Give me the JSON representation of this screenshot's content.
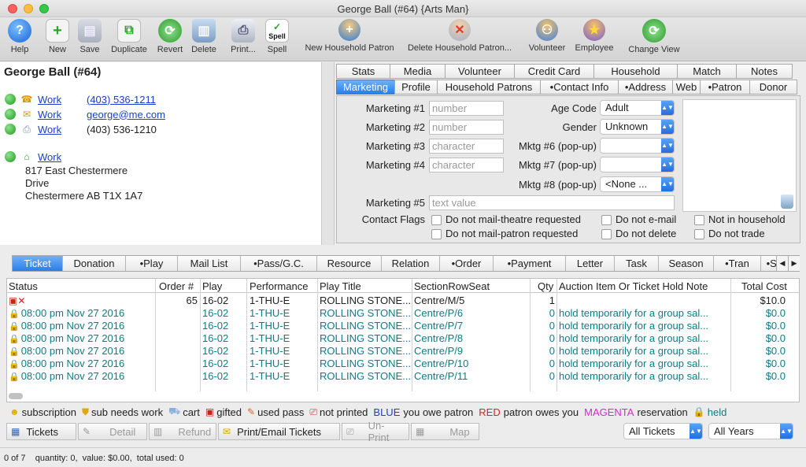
{
  "window": {
    "title": "George Ball (#64) {Arts Man}"
  },
  "toolbar": {
    "help": "Help",
    "new": "New",
    "save": "Save",
    "duplicate": "Duplicate",
    "revert": "Revert",
    "delete": "Delete",
    "print": "Print...",
    "spell": "Spell",
    "spell_badge": "Spell",
    "new_household_patron": "New Household Patron",
    "delete_household_patron": "Delete Household Patron...",
    "volunteer": "Volunteer",
    "employee": "Employee",
    "change_view": "Change View"
  },
  "contact": {
    "name": "George Ball (#64)",
    "phones": [
      {
        "type": "Work",
        "value": "(403) 536-1211",
        "linked": true
      },
      {
        "type": "Work",
        "value": "george@me.com",
        "linked": true
      },
      {
        "type": "Work",
        "value": "(403) 536-1210",
        "linked": false
      }
    ],
    "address": {
      "type": "Work",
      "line1": "817 East Chestermere",
      "line2": "Drive",
      "line3": "Chestermere AB  T1X 1A7"
    }
  },
  "right_tabs": {
    "row1": [
      "Stats",
      "Media",
      "Volunteer",
      "Credit Card",
      "Household",
      "Match",
      "Notes"
    ],
    "row2": [
      "Marketing",
      "Profile",
      "Household Patrons",
      "•Contact Info",
      "•Address",
      "Web",
      "•Patron",
      "Donor"
    ],
    "active": "Marketing"
  },
  "marketing": {
    "m1_label": "Marketing #1",
    "m1_placeholder": "number",
    "m2_label": "Marketing #2",
    "m2_placeholder": "number",
    "m3_label": "Marketing #3",
    "m3_placeholder": "character",
    "m4_label": "Marketing #4",
    "m4_placeholder": "character",
    "m5_label": "Marketing #5",
    "m5_placeholder": "text value",
    "age_label": "Age Code",
    "age_value": "Adult",
    "gender_label": "Gender",
    "gender_value": "Unknown",
    "m6_label": "Mktg #6 (pop-up)",
    "m6_value": "",
    "m7_label": "Mktg #7 (pop-up)",
    "m7_value": "",
    "m8_label": "Mktg #8 (pop-up)",
    "m8_value": "<None ...",
    "flags_label": "Contact Flags",
    "flags": [
      "Do not mail-theatre requested",
      "Do not e-mail",
      "Not in household",
      "Do not mail-patron requested",
      "Do not delete",
      "Do not trade"
    ]
  },
  "bottom_tabs": [
    "Ticket",
    "Donation",
    "•Play",
    "Mail List",
    "•Pass/G.C.",
    "Resource",
    "Relation",
    "•Order",
    "•Payment",
    "Letter",
    "Task",
    "Season",
    "•Tran",
    "•St"
  ],
  "tickets": {
    "columns": [
      "Status",
      "Order #",
      "Play",
      "Performance",
      "Play Title",
      "SectionRowSeat",
      "Qty",
      "Auction Item Or Ticket Hold Note",
      "Total Cost"
    ],
    "rows": [
      {
        "status": "",
        "order": "65",
        "play": "16-02",
        "perf": "1-THU-E",
        "title": "ROLLING STONE...",
        "seat": "Centre/M/5",
        "qty": "1",
        "note": "",
        "cost": "$10.0",
        "held": false
      },
      {
        "status": "08:00 pm Nov 27 2016",
        "order": "",
        "play": "16-02",
        "perf": "1-THU-E",
        "title": "ROLLING STONE...",
        "seat": "Centre/P/6",
        "qty": "0",
        "note": "hold temporarily for a group sal...",
        "cost": "$0.0",
        "held": true
      },
      {
        "status": "08:00 pm Nov 27 2016",
        "order": "",
        "play": "16-02",
        "perf": "1-THU-E",
        "title": "ROLLING STONE...",
        "seat": "Centre/P/7",
        "qty": "0",
        "note": "hold temporarily for a group sal...",
        "cost": "$0.0",
        "held": true
      },
      {
        "status": "08:00 pm Nov 27 2016",
        "order": "",
        "play": "16-02",
        "perf": "1-THU-E",
        "title": "ROLLING STONE...",
        "seat": "Centre/P/8",
        "qty": "0",
        "note": "hold temporarily for a group sal...",
        "cost": "$0.0",
        "held": true
      },
      {
        "status": "08:00 pm Nov 27 2016",
        "order": "",
        "play": "16-02",
        "perf": "1-THU-E",
        "title": "ROLLING STONE...",
        "seat": "Centre/P/9",
        "qty": "0",
        "note": "hold temporarily for a group sal...",
        "cost": "$0.0",
        "held": true
      },
      {
        "status": "08:00 pm Nov 27 2016",
        "order": "",
        "play": "16-02",
        "perf": "1-THU-E",
        "title": "ROLLING STONE...",
        "seat": "Centre/P/10",
        "qty": "0",
        "note": "hold temporarily for a group sal...",
        "cost": "$0.0",
        "held": true
      },
      {
        "status": "08:00 pm Nov 27 2016",
        "order": "",
        "play": "16-02",
        "perf": "1-THU-E",
        "title": "ROLLING STONE...",
        "seat": "Centre/P/11",
        "qty": "0",
        "note": "hold temporarily for a group sal...",
        "cost": "$0.0",
        "held": true
      }
    ]
  },
  "legend": {
    "subscription": "subscription",
    "sub_needs_work": "sub needs work",
    "cart": "cart",
    "gifted": "gifted",
    "used_pass": "used pass",
    "not_printed": "not printed",
    "blue_word": "BLUE",
    "blue_text": "you owe patron",
    "red_word": "RED",
    "red_text": "patron owes you",
    "magenta_word": "MAGENTA",
    "magenta_text": "reservation",
    "held": "held"
  },
  "actions": {
    "tickets": "Tickets",
    "detail": "Detail",
    "refund": "Refund",
    "print_email": "Print/Email Tickets",
    "unprint": "Un-Print",
    "map": "Map",
    "filter1": "All Tickets",
    "filter2": "All Years"
  },
  "status": {
    "text": "0 of 7    quantity: 0,  value: $0.00,  total used: 0"
  },
  "colors": {
    "accent": "#2a7ee9",
    "teal": "#0b7d84",
    "blue": "#1a3fcc",
    "red": "#d8231f",
    "magenta": "#d02bd0"
  }
}
